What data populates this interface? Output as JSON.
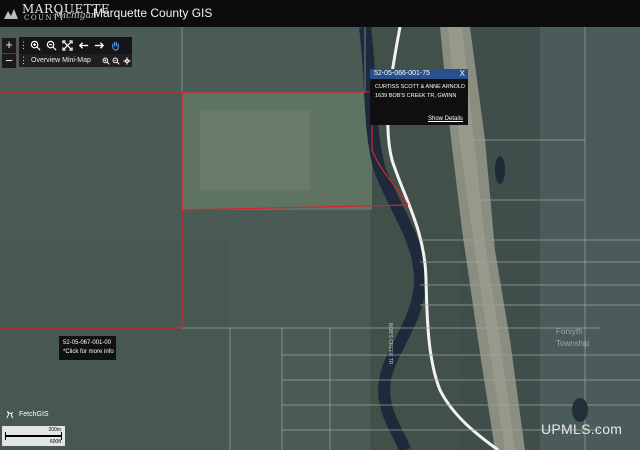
{
  "header": {
    "logo_text": "MARQUETTE",
    "logo_sub": "COUNTY",
    "logo_script": "Michigan",
    "title": "Marquette County GIS"
  },
  "zoom": {
    "in_label": "+",
    "out_label": "−"
  },
  "toolbar": {
    "grip": "⋮",
    "icons": [
      "zoom-in-icon",
      "zoom-out-icon",
      "full-extent-icon",
      "back-arrow-icon",
      "forward-arrow-icon",
      "pan-hand-icon"
    ]
  },
  "overview": {
    "grip": "⋮",
    "label": "Overview Mini-Map"
  },
  "popup": {
    "parcel_id": "52-05-066-001-75",
    "close": "X",
    "owner": "CURTISS SCOTT & ANNE ARNOLD",
    "address": "1639 BOB'S CREEK TR, GWINN",
    "link": "Show Details"
  },
  "tooltip": {
    "parcel_id": "52-05-067-001-00",
    "hint": "*Click for more info"
  },
  "fetch": {
    "label": "FetchGIS"
  },
  "scale": {
    "top": "200m",
    "bottom": "600ft"
  },
  "map_labels": {
    "township_line1": "Forsyth",
    "township_line2": "Township",
    "road": "BOB'S CREEK TR"
  },
  "watermark": "UPMLS.com",
  "colors": {
    "header_bg": "#0c0c0c",
    "popup_header": "#2a4f8a",
    "parcel_selected": "#d8232a",
    "parcel_lines": "#9ea3a3"
  }
}
